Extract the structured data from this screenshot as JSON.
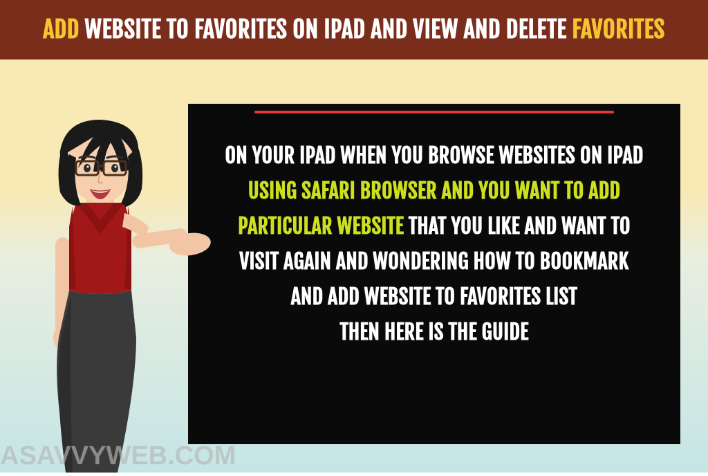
{
  "header": {
    "add": "ADD",
    "middle": "WEBSITE TO FAVORITES ON IPAD AND VIEW AND DELETE",
    "favorites": "FAVORITES"
  },
  "content": {
    "line1": "ON YOUR IPAD WHEN YOU BROWSE WEBSITES ON IPAD",
    "line2": "USING SAFARI BROWSER AND YOU WANT TO ADD",
    "line3a": "PARTICULAR WEBSITE",
    "line3b": "THAT YOU LIKE AND WANT TO",
    "line4": "VISIT AGAIN AND WONDERING HOW TO BOOKMARK",
    "line5": "AND ADD WEBSITE TO FAVORITES LIST",
    "line6": "THEN HERE IS THE GUIDE"
  },
  "watermark": "ASAVVYWEB.COM"
}
